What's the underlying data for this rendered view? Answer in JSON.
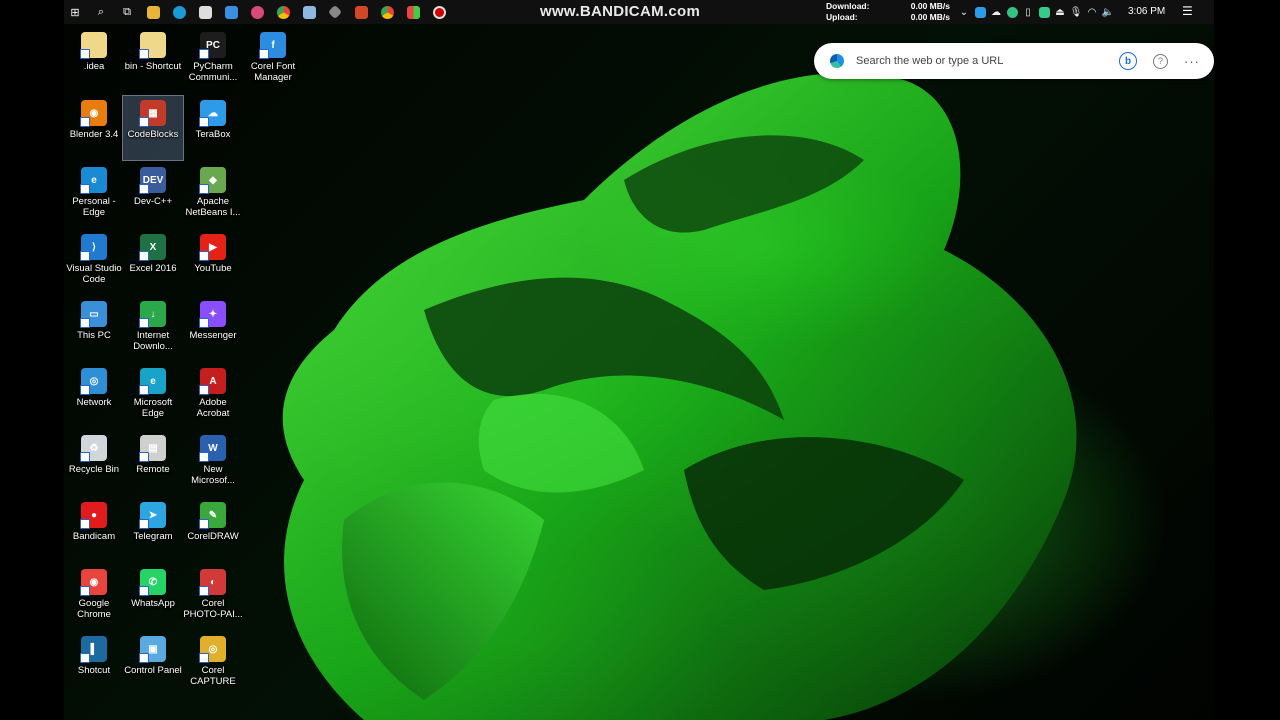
{
  "taskbar": {
    "watermark": "www.BANDICAM.com",
    "download_label": "Download:",
    "download_value": "0.00 MB/s",
    "upload_label": "Upload:",
    "upload_value": "0.00 MB/s",
    "clock": "3:06 PM",
    "pinned_icons": [
      "windows-start-icon",
      "search-icon",
      "task-view-icon",
      "file-explorer-icon",
      "edge-icon",
      "store-icon",
      "mail-icon",
      "media-icon",
      "chrome-icon",
      "photos-icon",
      "git-icon",
      "powerpoint-icon",
      "chrome-alt-icon",
      "grid-icon",
      "record-icon"
    ]
  },
  "search": {
    "placeholder": "Search the web or type a URL",
    "bing_glyph": "b",
    "help_glyph": "?",
    "more_glyph": "···"
  },
  "desktop_icons": [
    {
      "label": ".idea",
      "color": "#f0d88a",
      "glyph": ""
    },
    {
      "label": "bin - Shortcut",
      "color": "#f0d88a",
      "glyph": ""
    },
    {
      "label": "PyCharm Communi...",
      "color": "#1d1d1d",
      "glyph": "PC"
    },
    {
      "label": "Corel Font Manager",
      "color": "#2c8de0",
      "glyph": "f"
    },
    {
      "label": "Blender 3.4",
      "color": "#e87d0d",
      "glyph": "◉"
    },
    {
      "label": "CodeBlocks",
      "color": "#c23a2a",
      "glyph": "▦"
    },
    {
      "label": "TeraBox",
      "color": "#2e9be8",
      "glyph": "☁"
    },
    {
      "label": "Personal - Edge",
      "color": "#1a8ad4",
      "glyph": "e"
    },
    {
      "label": "Dev-C++",
      "color": "#3a5b9c",
      "glyph": "DEV"
    },
    {
      "label": "Apache NetBeans I...",
      "color": "#6aa84f",
      "glyph": "◆"
    },
    {
      "label": "Visual Studio Code",
      "color": "#1f7ad0",
      "glyph": "⟩"
    },
    {
      "label": "Excel 2016",
      "color": "#1f7244",
      "glyph": "X"
    },
    {
      "label": "YouTube",
      "color": "#e62117",
      "glyph": "▶"
    },
    {
      "label": "This PC",
      "color": "#3a8fd8",
      "glyph": "▭"
    },
    {
      "label": "Internet Downlo...",
      "color": "#2aa84a",
      "glyph": "↓"
    },
    {
      "label": "Messenger",
      "color": "#8a4dff",
      "glyph": "✦"
    },
    {
      "label": "Network",
      "color": "#2f8fd6",
      "glyph": "◎"
    },
    {
      "label": "Microsoft Edge",
      "color": "#1aa3c8",
      "glyph": "e"
    },
    {
      "label": "Adobe Acrobat",
      "color": "#c41e1e",
      "glyph": "A"
    },
    {
      "label": "Recycle Bin",
      "color": "#cfd6dc",
      "glyph": "♻"
    },
    {
      "label": "Remote",
      "color": "#cfcfcf",
      "glyph": "▤"
    },
    {
      "label": "New Microsof...",
      "color": "#2b5faf",
      "glyph": "W"
    },
    {
      "label": "Bandicam",
      "color": "#e21c1c",
      "glyph": "●"
    },
    {
      "label": "Telegram",
      "color": "#2ca5e0",
      "glyph": "➤"
    },
    {
      "label": "CorelDRAW",
      "color": "#3aa83a",
      "glyph": "✎"
    },
    {
      "label": "Google Chrome",
      "color": "#e8453c",
      "glyph": "◉"
    },
    {
      "label": "WhatsApp",
      "color": "#25d366",
      "glyph": "✆"
    },
    {
      "label": "Corel PHOTO-PAI...",
      "color": "#d23a3a",
      "glyph": "◐"
    },
    {
      "label": "Shotcut",
      "color": "#1d6aa0",
      "glyph": "▌"
    },
    {
      "label": "Control Panel",
      "color": "#5aa9e0",
      "glyph": "▣"
    },
    {
      "label": "Corel CAPTURE",
      "color": "#e0b02a",
      "glyph": "◎"
    }
  ]
}
